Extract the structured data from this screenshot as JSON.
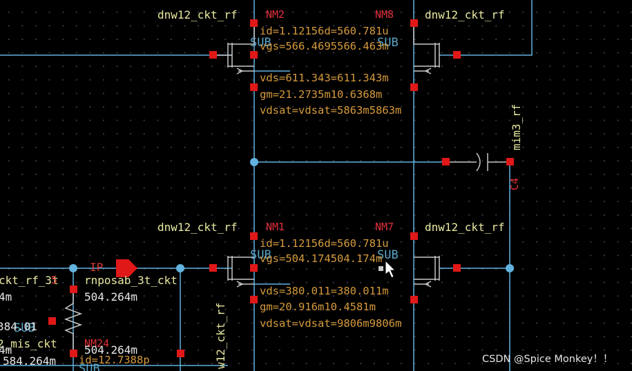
{
  "cells": {
    "nm2_cell": "dnw12_ckt_rf",
    "nm8_cell": "dnw12_ckt_rf",
    "nm1_cell": "dnw12_ckt_rf",
    "nm7_cell": "dnw12_ckt_rf",
    "cap_cell": "mim3_rf",
    "res_cell": "rnposab_3t_ckt",
    "left_cell": "ckt_rf_3t",
    "left_cell2": "2_mis_ckt",
    "vert_cell": "w12_ckt_rf"
  },
  "instances": {
    "nm2": "NM2",
    "nm8": "NM8",
    "nm1": "NM1",
    "nm7": "NM7",
    "cap": "C4",
    "nm24": "NM24",
    "left_inst": "5"
  },
  "params": {
    "nm2_nm8_id": "id=1.12156d=560.781u",
    "nm2_nm8_vgs": "vgs=566.4695566.463m",
    "nm2_nm8_vds": "vds=611.343=611.343m",
    "nm2_nm8_gm": "gm=21.2735m10.6368m",
    "nm2_nm8_vdsat": "vdsat=vdsat=5863m5863m",
    "nm1_nm7_id": "id=1.12156d=560.781u",
    "nm1_nm7_vgs": "vgs=504.174504.174m",
    "nm1_nm7_vds": "vds=380.011=380.011m",
    "nm1_nm7_gm": "gm=20.916m10.4581m",
    "nm1_nm7_vdsat": "vdsat=vdsat=9806m9806m",
    "nm24_id": "id=12.7388p"
  },
  "nets": {
    "ip": "IP",
    "sub_nm2": "SUB",
    "sub_nm8": "SUB",
    "sub_nm1": "SUB",
    "sub_nm7": "SUB",
    "sub_left": "SUB",
    "sub_bottom": "SUB"
  },
  "values": {
    "res_v": "504.264m",
    "nm24_v": "504.264m",
    "left_v": "4m",
    "left_v2": "4m",
    "left_v3": "584.264m",
    "left_id": "384.01"
  },
  "watermark": "CSDN @Spice Monkey！！",
  "colors": {
    "wire": "#62b3df",
    "pin": "#e01818",
    "device": "#c8c8c8",
    "instance": "#e0303a",
    "cell": "#e8e8a0",
    "param": "#d69a3c"
  }
}
